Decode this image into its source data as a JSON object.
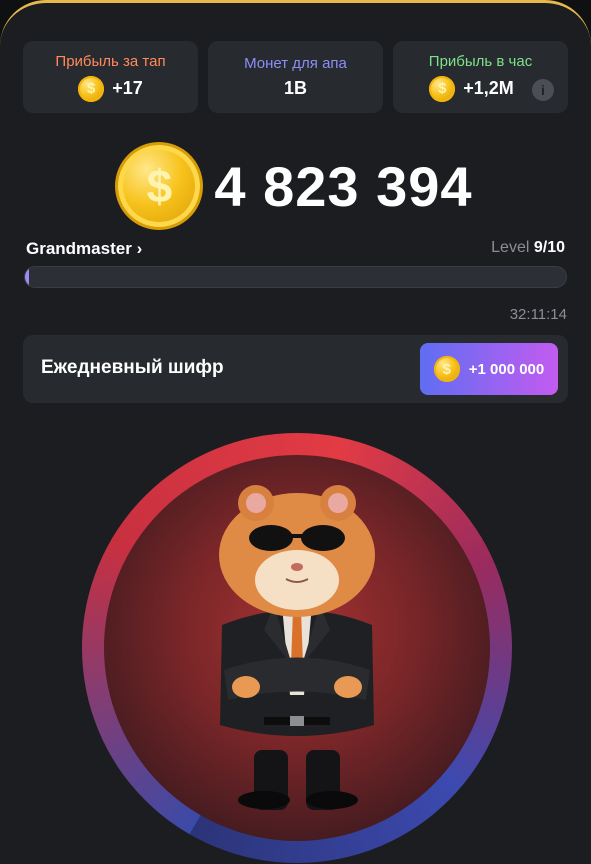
{
  "stats": [
    {
      "label": "Прибыль за тап",
      "value": "+17",
      "color": "#ff8a5c"
    },
    {
      "label": "Монет для апа",
      "value": "1B",
      "color": "#8a8ff5"
    },
    {
      "label": "Прибыль в час",
      "value": "+1,2M",
      "color": "#7ee08a"
    }
  ],
  "info_icon": "i",
  "coin_symbol": "$",
  "balance": "4 823 394",
  "rank": "Grandmaster",
  "rank_chevron": "›",
  "level": {
    "label": "Level",
    "value": "9/10"
  },
  "progress": {
    "fraction": 0.005,
    "color": "#9c8bf2"
  },
  "timer": "32:11:14",
  "daily_cipher": {
    "title": "Ежедневный шифр",
    "reward": "+1 000 000"
  },
  "icons": [
    "coin-icon",
    "info-icon",
    "chevron-right-icon",
    "hamster-character"
  ],
  "colors": {
    "accent_gold": "#f7c21b",
    "button_start": "#5f6ef2",
    "button_end": "#c35bf0"
  }
}
